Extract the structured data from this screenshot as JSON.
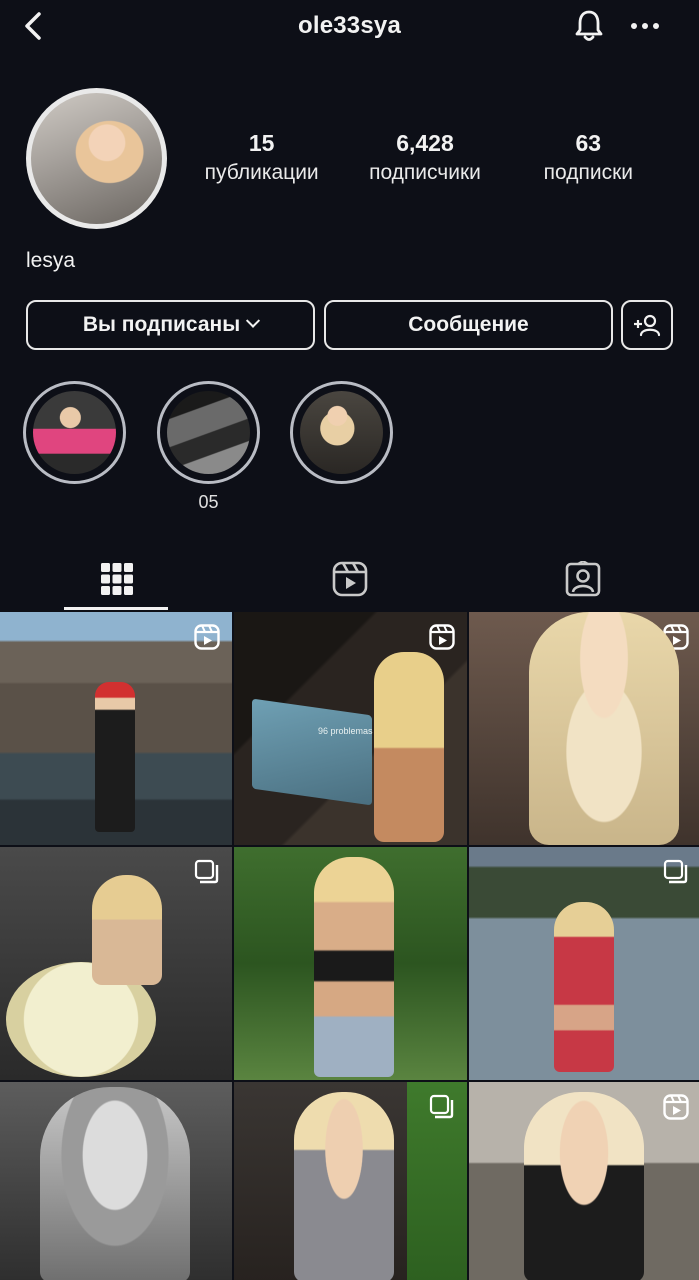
{
  "header": {
    "username": "ole33sya",
    "back_icon": "chevron-left-icon",
    "bell_icon": "bell-icon",
    "more_icon": "more-horizontal-icon"
  },
  "profile": {
    "display_name": "lesya",
    "stats": [
      {
        "value": "15",
        "label": "публикации"
      },
      {
        "value": "6,428",
        "label": "подписчики"
      },
      {
        "value": "63",
        "label": "подписки"
      }
    ]
  },
  "actions": {
    "following_label": "Вы подписаны",
    "message_label": "Сообщение",
    "add_person_icon": "add-person-icon"
  },
  "highlights": [
    {
      "label": ""
    },
    {
      "label": "05"
    },
    {
      "label": ""
    }
  ],
  "tabs": [
    {
      "name": "posts",
      "icon": "grid-icon",
      "active": true
    },
    {
      "name": "reels",
      "icon": "reels-icon",
      "active": false
    },
    {
      "name": "tagged",
      "icon": "tagged-person-icon",
      "active": false
    }
  ],
  "posts": [
    {
      "type": "reel"
    },
    {
      "type": "reel",
      "caption": "96 problemas"
    },
    {
      "type": "reel"
    },
    {
      "type": "carousel"
    },
    {
      "type": "photo"
    },
    {
      "type": "carousel"
    },
    {
      "type": "photo"
    },
    {
      "type": "carousel"
    },
    {
      "type": "reel"
    }
  ],
  "colors": {
    "background": "#0d0f17",
    "text": "#f2f2f2",
    "border": "#e8e8e8"
  }
}
